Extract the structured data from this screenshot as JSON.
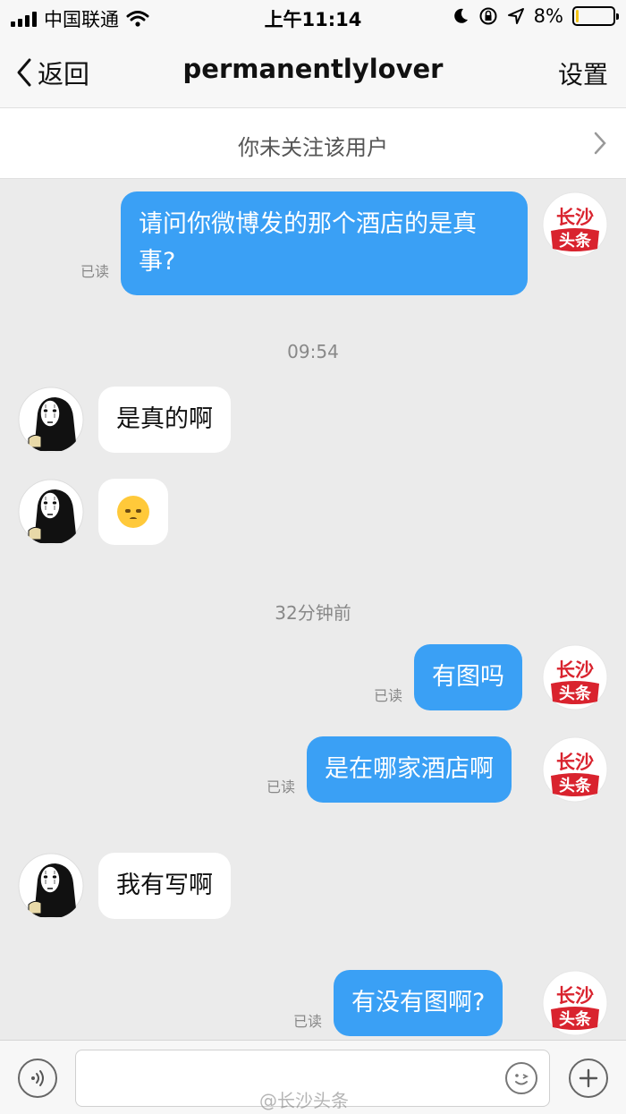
{
  "status_bar": {
    "carrier": "中国联通",
    "time": "上午11:14",
    "battery_percent": "8%",
    "battery_level": 0.08,
    "icons": [
      "signal-icon",
      "wifi-icon",
      "moon-icon",
      "rotation-lock-icon",
      "location-arrow-icon",
      "battery-icon"
    ]
  },
  "nav": {
    "back_label": "返回",
    "title": "permanentlylover",
    "settings_label": "设置"
  },
  "banner": {
    "text": "你未关注该用户"
  },
  "logo_text": {
    "line1": "长沙",
    "line2": "头条"
  },
  "messages": [
    {
      "sender": "me",
      "text": "请问你微博发的那个酒店的是真事?",
      "read": "已读"
    },
    {
      "type": "timestamp",
      "text": "09:54"
    },
    {
      "sender": "them",
      "text": "是真的啊"
    },
    {
      "sender": "them",
      "emoji": "flushed-face"
    },
    {
      "type": "timestamp",
      "text": "32分钟前"
    },
    {
      "sender": "me",
      "text": "有图吗",
      "read": "已读"
    },
    {
      "sender": "me",
      "text": "是在哪家酒店啊",
      "read": "已读"
    },
    {
      "sender": "them",
      "text": "我有写啊"
    },
    {
      "sender": "me",
      "text": "有没有图啊?",
      "read": "已读"
    }
  ],
  "input": {
    "placeholder": "",
    "watermark": "@长沙头条"
  },
  "colors": {
    "outgoing_bubble": "#3aa0f5",
    "incoming_bubble": "#ffffff",
    "background": "#ebebeb",
    "brand_red": "#d9232e"
  }
}
